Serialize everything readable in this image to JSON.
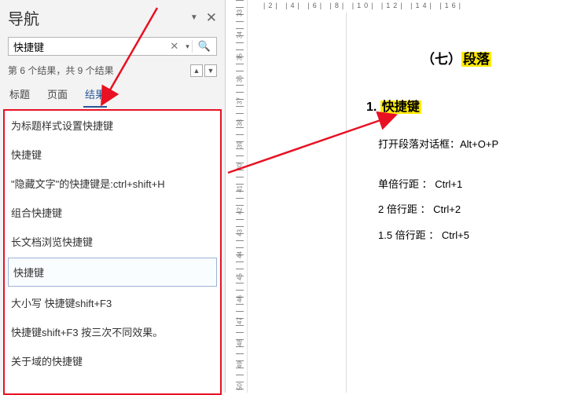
{
  "panel": {
    "title": "导航"
  },
  "search": {
    "value": "快捷键",
    "placeholder": ""
  },
  "status": {
    "text": "第 6 个结果，共 9 个结果"
  },
  "tabs": {
    "t0": "标题",
    "t1": "页面",
    "t2": "结果"
  },
  "results": {
    "r0": "为标题样式设置快捷键",
    "r1": "快捷键",
    "r2": "\"隐藏文字\"的快捷键是:ctrl+shift+H",
    "r3": "组合快捷键",
    "r4": "长文档浏览快捷键",
    "r5": "快捷键",
    "r6": "大小写 快捷键shift+F3",
    "r7": "快捷键shift+F3 按三次不同效果。",
    "r8": "关于域的快捷键"
  },
  "doc": {
    "heading_pre": "（七）",
    "heading_hl": "段落",
    "h1_num": "1. ",
    "h1_hl": "快捷键",
    "p1": "打开段落对话框：Alt+O+P",
    "p2": "单倍行距 ： Ctrl+1",
    "p3": "2 倍行距 ： Ctrl+2",
    "p4": "1.5 倍行距 ： Ctrl+5"
  },
  "ruler": {
    "h": "|2| |4| |6| |8| |10| |12| |14| |16|"
  },
  "vnums": {
    "n33": "33",
    "n34": "34",
    "n35": "35",
    "n36": "36",
    "n37": "37",
    "n38": "38",
    "n39": "39",
    "n40": "40",
    "n41": "41",
    "n42": "42",
    "n43": "43",
    "n44": "44",
    "n45": "45",
    "n46": "46",
    "n47": "47",
    "n48": "48",
    "n49": "49",
    "n50": "50"
  }
}
